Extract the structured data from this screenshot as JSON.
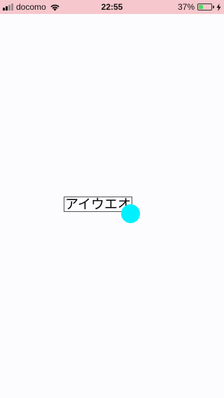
{
  "status_bar": {
    "carrier": "docomo",
    "time": "22:55",
    "battery_percent": "37%",
    "battery_level": 0.37,
    "icons": [
      "signal-icon",
      "wifi-icon",
      "battery-icon",
      "charging-icon"
    ],
    "background_color": "#f6c7cc",
    "battery_color": "#4cd964"
  },
  "main": {
    "text_field_value": "アイウエオ",
    "touch_indicator_color": "#00f0ff"
  }
}
